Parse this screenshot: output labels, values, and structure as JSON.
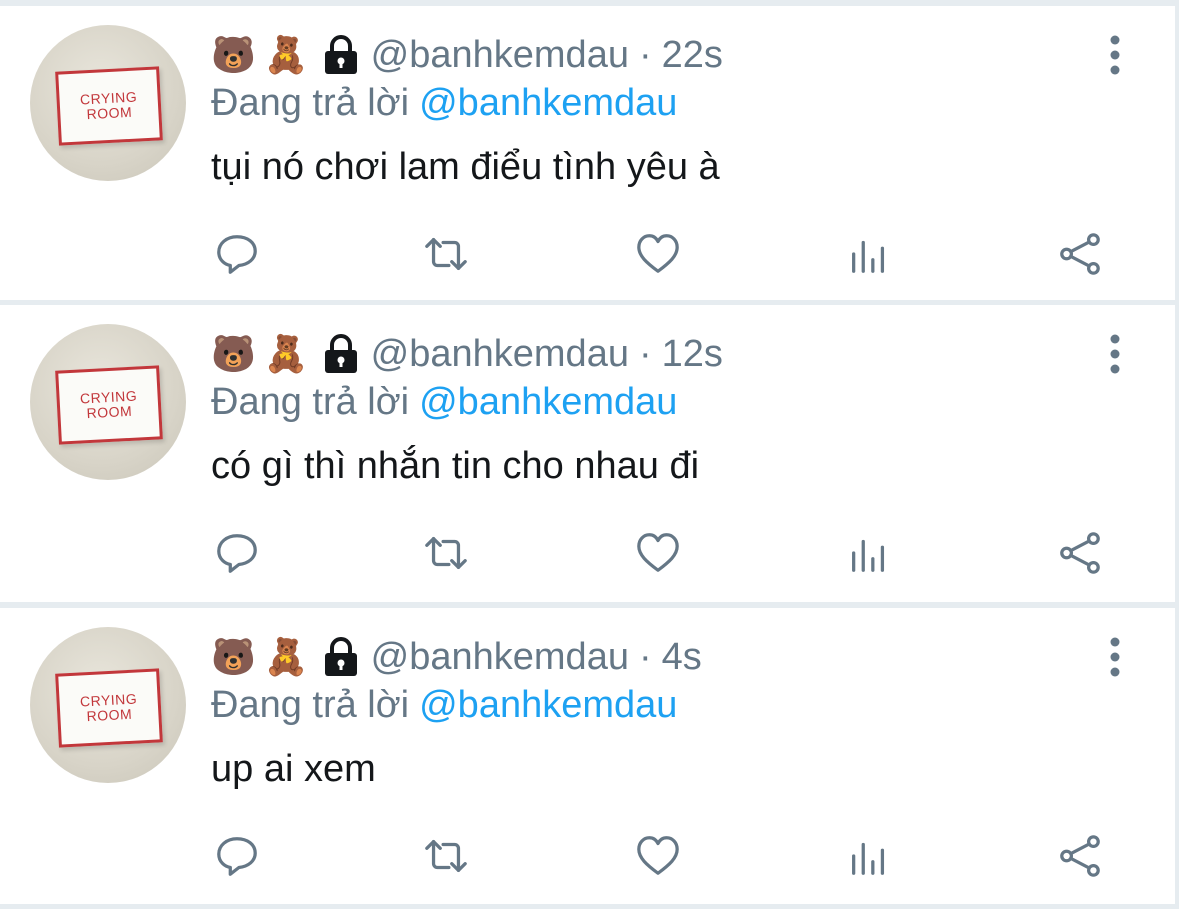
{
  "tweets": [
    {
      "avatar_text": [
        "CRYING",
        "ROOM"
      ],
      "emojis": [
        "🐻",
        "🧸"
      ],
      "handle": "@banhkemdau",
      "separator": "·",
      "time": "22s",
      "reply_prefix": "Đang trả lời",
      "reply_to": "@banhkemdau",
      "text": "tụi nó chơi lam điểu tình yêu à"
    },
    {
      "avatar_text": [
        "CRYING",
        "ROOM"
      ],
      "emojis": [
        "🐻",
        "🧸"
      ],
      "handle": "@banhkemdau",
      "separator": "·",
      "time": "12s",
      "reply_prefix": "Đang trả lời",
      "reply_to": "@banhkemdau",
      "text": "có gì thì nhắn tin cho nhau đi"
    },
    {
      "avatar_text": [
        "CRYING",
        "ROOM"
      ],
      "emojis": [
        "🐻",
        "🧸"
      ],
      "handle": "@banhkemdau",
      "separator": "·",
      "time": "4s",
      "reply_prefix": "Đang trả lời",
      "reply_to": "@banhkemdau",
      "text": "up ai xem"
    }
  ],
  "icons": {
    "lock": "lock-icon",
    "more": "more-vertical-icon",
    "reply": "reply-icon",
    "retweet": "retweet-icon",
    "like": "heart-icon",
    "stats": "stats-icon",
    "share": "share-icon"
  },
  "colors": {
    "muted": "#657786",
    "link": "#1da1f2",
    "text": "#14171a",
    "separator_bg": "#e6ecf0"
  }
}
